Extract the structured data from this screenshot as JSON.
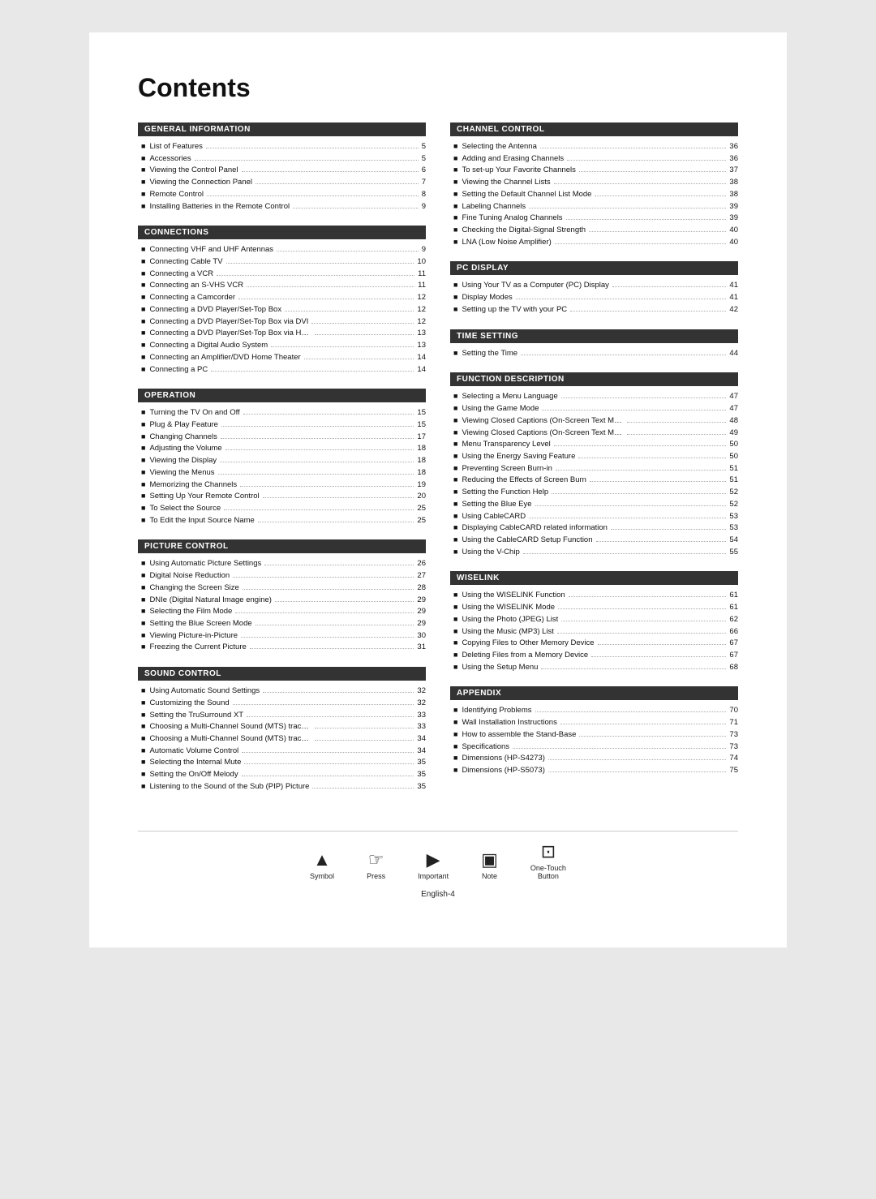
{
  "title": "Contents",
  "footer_page": "English-4",
  "sections_left": [
    {
      "id": "general-information",
      "header": "GENERAL INFORMATION",
      "items": [
        {
          "label": "List of Features",
          "page": "5"
        },
        {
          "label": "Accessories",
          "page": "5"
        },
        {
          "label": "Viewing the Control Panel",
          "page": "6"
        },
        {
          "label": "Viewing the Connection Panel",
          "page": "7"
        },
        {
          "label": "Remote Control",
          "page": "8"
        },
        {
          "label": "Installing Batteries in the Remote Control",
          "page": "9"
        }
      ]
    },
    {
      "id": "connections",
      "header": "CONNECTIONS",
      "items": [
        {
          "label": "Connecting VHF and UHF Antennas",
          "page": "9"
        },
        {
          "label": "Connecting Cable TV",
          "page": "10"
        },
        {
          "label": "Connecting a VCR",
          "page": "11"
        },
        {
          "label": "Connecting an S-VHS VCR",
          "page": "11"
        },
        {
          "label": "Connecting a Camcorder",
          "page": "12"
        },
        {
          "label": "Connecting a DVD Player/Set-Top Box",
          "page": "12"
        },
        {
          "label": "Connecting a DVD Player/Set-Top Box via DVI",
          "page": "12"
        },
        {
          "label": "Connecting a DVD Player/Set-Top Box via HDMI",
          "page": "13"
        },
        {
          "label": "Connecting a Digital Audio System",
          "page": "13"
        },
        {
          "label": "Connecting an Amplifier/DVD Home Theater",
          "page": "14"
        },
        {
          "label": "Connecting a PC",
          "page": "14"
        }
      ]
    },
    {
      "id": "operation",
      "header": "OPERATION",
      "items": [
        {
          "label": "Turning the TV On and Off",
          "page": "15"
        },
        {
          "label": "Plug & Play Feature",
          "page": "15"
        },
        {
          "label": "Changing Channels",
          "page": "17"
        },
        {
          "label": "Adjusting the Volume",
          "page": "18"
        },
        {
          "label": "Viewing the Display",
          "page": "18"
        },
        {
          "label": "Viewing the Menus",
          "page": "18"
        },
        {
          "label": "Memorizing the Channels",
          "page": "19"
        },
        {
          "label": "Setting Up Your Remote Control",
          "page": "20"
        },
        {
          "label": "To Select the Source",
          "page": "25"
        },
        {
          "label": "To Edit the Input Source Name",
          "page": "25"
        }
      ]
    },
    {
      "id": "picture-control",
      "header": "PICTURE CONTROL",
      "items": [
        {
          "label": "Using Automatic Picture Settings",
          "page": "26"
        },
        {
          "label": "Digital Noise Reduction",
          "page": "27"
        },
        {
          "label": "Changing the Screen Size",
          "page": "28"
        },
        {
          "label": "DNIe (Digital Natural Image engine)",
          "page": "29"
        },
        {
          "label": "Selecting the Film Mode",
          "page": "29"
        },
        {
          "label": "Setting the Blue Screen Mode",
          "page": "29"
        },
        {
          "label": "Viewing Picture-in-Picture",
          "page": "30"
        },
        {
          "label": "Freezing the Current Picture",
          "page": "31"
        }
      ]
    },
    {
      "id": "sound-control",
      "header": "SOUND CONTROL",
      "items": [
        {
          "label": "Using Automatic Sound Settings",
          "page": "32"
        },
        {
          "label": "Customizing the Sound",
          "page": "32"
        },
        {
          "label": "Setting the TruSurround XT",
          "page": "33"
        },
        {
          "label": "Choosing a Multi-Channel Sound (MTS) track - Digital",
          "page": "33"
        },
        {
          "label": "Choosing a Multi-Channel Sound (MTS) track - Analog",
          "page": "34"
        },
        {
          "label": "Automatic Volume Control",
          "page": "34"
        },
        {
          "label": "Selecting the Internal Mute",
          "page": "35"
        },
        {
          "label": "Setting the On/Off Melody",
          "page": "35"
        },
        {
          "label": "Listening to the Sound of the Sub (PIP) Picture",
          "page": "35"
        }
      ]
    }
  ],
  "sections_right": [
    {
      "id": "channel-control",
      "header": "CHANNEL CONTROL",
      "items": [
        {
          "label": "Selecting the Antenna",
          "page": "36"
        },
        {
          "label": "Adding and Erasing Channels",
          "page": "36"
        },
        {
          "label": "To set-up Your Favorite Channels",
          "page": "37"
        },
        {
          "label": "Viewing the Channel Lists",
          "page": "38"
        },
        {
          "label": "Setting the Default Channel List Mode",
          "page": "38"
        },
        {
          "label": "Labeling Channels",
          "page": "39"
        },
        {
          "label": "Fine Tuning Analog Channels",
          "page": "39"
        },
        {
          "label": "Checking the Digital-Signal Strength",
          "page": "40"
        },
        {
          "label": "LNA (Low Noise Amplifier)",
          "page": "40"
        }
      ]
    },
    {
      "id": "pc-display",
      "header": "PC DISPLAY",
      "items": [
        {
          "label": "Using Your TV as a Computer (PC) Display",
          "page": "41"
        },
        {
          "label": "Display Modes",
          "page": "41"
        },
        {
          "label": "Setting up the TV with your PC",
          "page": "42"
        }
      ]
    },
    {
      "id": "time-setting",
      "header": "TIME SETTING",
      "items": [
        {
          "label": "Setting the Time",
          "page": "44"
        }
      ]
    },
    {
      "id": "function-description",
      "header": "FUNCTION DESCRIPTION",
      "items": [
        {
          "label": "Selecting a Menu Language",
          "page": "47"
        },
        {
          "label": "Using the Game Mode",
          "page": "47"
        },
        {
          "label": "Viewing Closed Captions (On-Screen Text Messages) - Digital",
          "page": "48"
        },
        {
          "label": "Viewing Closed Captions (On-Screen Text Messages) - Analog",
          "page": "49"
        },
        {
          "label": "Menu Transparency Level",
          "page": "50"
        },
        {
          "label": "Using the Energy Saving Feature",
          "page": "50"
        },
        {
          "label": "Preventing Screen Burn-in",
          "page": "51"
        },
        {
          "label": "Reducing the Effects of Screen Burn",
          "page": "51"
        },
        {
          "label": "Setting the Function Help",
          "page": "52"
        },
        {
          "label": "Setting the Blue Eye",
          "page": "52"
        },
        {
          "label": "Using CableCARD",
          "page": "53"
        },
        {
          "label": "Displaying CableCARD related information",
          "page": "53"
        },
        {
          "label": "Using the CableCARD Setup Function",
          "page": "54"
        },
        {
          "label": "Using the V-Chip",
          "page": "55"
        }
      ]
    },
    {
      "id": "wiselink",
      "header": "WISELINK",
      "items": [
        {
          "label": "Using the WISELINK Function",
          "page": "61"
        },
        {
          "label": "Using the WISELINK Mode",
          "page": "61"
        },
        {
          "label": "Using the Photo (JPEG) List",
          "page": "62"
        },
        {
          "label": "Using the Music (MP3) List",
          "page": "66"
        },
        {
          "label": "Copying Files to Other Memory Device",
          "page": "67"
        },
        {
          "label": "Deleting Files from a Memory Device",
          "page": "67"
        },
        {
          "label": "Using the Setup Menu",
          "page": "68"
        }
      ]
    },
    {
      "id": "appendix",
      "header": "APPENDIX",
      "items": [
        {
          "label": "Identifying Problems",
          "page": "70"
        },
        {
          "label": "Wall Installation Instructions",
          "page": "71"
        },
        {
          "label": "How to assemble the Stand-Base",
          "page": "73"
        },
        {
          "label": "Specifications",
          "page": "73"
        },
        {
          "label": "Dimensions (HP-S4273)",
          "page": "74"
        },
        {
          "label": "Dimensions (HP-S5073)",
          "page": "75"
        }
      ]
    }
  ],
  "footer_icons": [
    {
      "id": "symbol",
      "icon": "▲",
      "label": "Symbol"
    },
    {
      "id": "press",
      "icon": "🖐",
      "label": "Press"
    },
    {
      "id": "important",
      "icon": "➤",
      "label": "Important"
    },
    {
      "id": "note",
      "icon": "📄",
      "label": "Note"
    },
    {
      "id": "one-touch-button",
      "icon": "⊡",
      "label": "One-Touch\nButton"
    }
  ]
}
